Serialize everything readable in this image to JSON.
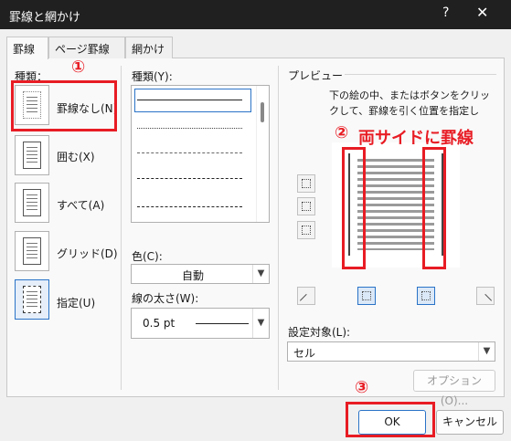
{
  "title": "罫線と網かけ",
  "title_help": "?",
  "title_close": "✕",
  "tabs": [
    "罫線",
    "ページ罫線",
    "網かけ"
  ],
  "settings": {
    "label": "種類：",
    "items": [
      "罫線なし(N)",
      "囲む(X)",
      "すべて(A)",
      "グリッド(D)",
      "指定(U)"
    ]
  },
  "style": {
    "label": "種類(Y):",
    "color_label": "色(C):",
    "color_value": "自動",
    "width_label": "線の太さ(W):",
    "width_value": "0.5 pt"
  },
  "preview": {
    "label": "プレビュー",
    "hint_line1": "下の絵の中、またはボタンをクリッ",
    "hint_line2": "クして、罫線を引く位置を指定し",
    "apply_label": "設定対象(L):",
    "apply_value": "セル",
    "options_button": "オプション(O)..."
  },
  "annotations": {
    "n1": "①",
    "n2": "②",
    "n2_text": "両サイドに罫線",
    "n3": "③"
  },
  "buttons": {
    "ok": "OK",
    "cancel": "キャンセル"
  },
  "colors": {
    "annotation": "#e81c24",
    "titlebar": "#202020",
    "accent": "#2a73c7"
  }
}
